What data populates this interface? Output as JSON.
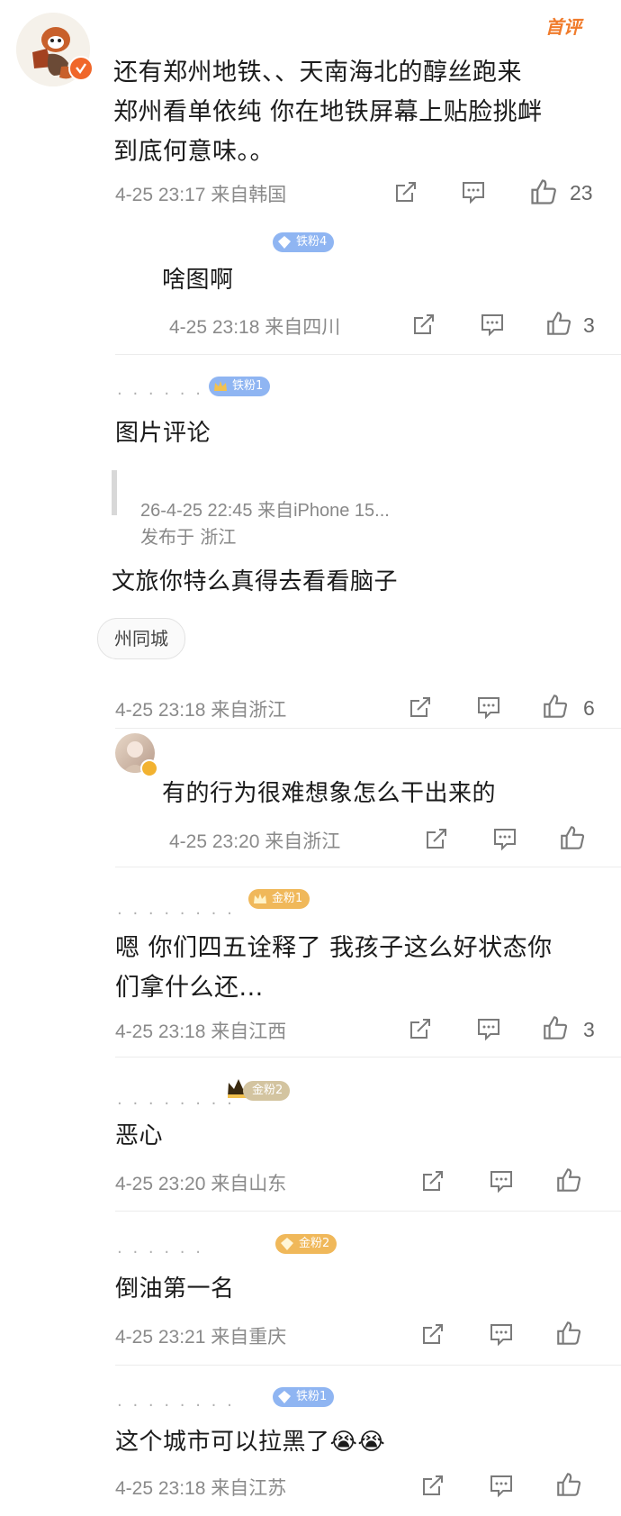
{
  "top_comment": {
    "tag": "首评",
    "lines": [
      "还有郑州地铁、、天南海北的醇丝跑来",
      "郑州看单依纯 你在地铁屏幕上贴脸挑衅",
      "到底何意味。。"
    ],
    "time": "4-25 23:17 来自韩国",
    "likes": "23"
  },
  "replies": [
    {
      "badge": "铁粉4",
      "text": "啥图啊",
      "time": "4-25 23:18 来自四川",
      "likes": "3"
    },
    {
      "badge": "铁粉1",
      "text": "图片评论",
      "quoted_time": "26-4-25 22:45  来自iPhone 15...",
      "quoted_loc": "发布于 浙江",
      "extra_text": "文旅你特么真得去看看脑子",
      "tag": "州同城",
      "time": "4-25 23:18 来自浙江",
      "likes": "6"
    },
    {
      "text": "有的行为很难想象怎么干出来的",
      "time": "4-25 23:20 来自浙江",
      "likes": ""
    },
    {
      "badge": "金粉1",
      "lines": [
        "嗯 你们四五诠释了 我孩子这么好状态你",
        "们拿什么还..."
      ],
      "time": "4-25 23:18 来自江西",
      "likes": "3"
    },
    {
      "badge": "金粉2",
      "text": "恶心",
      "time": "4-25 23:20 来自山东",
      "likes": ""
    },
    {
      "badge": "金粉2",
      "text": "倒油第一名",
      "time": "4-25 23:21 来自重庆",
      "likes": ""
    },
    {
      "badge": "铁粉1",
      "text": "这个城市可以拉黑了😭😭",
      "time": "4-25 23:18 来自江苏",
      "likes": ""
    }
  ],
  "icons": [
    "share-icon",
    "comment-icon",
    "thumbs-up-icon"
  ],
  "colors": {
    "tag": "#f07b2b",
    "badge_blue": "#8fb5f2",
    "badge_gold": "#f0b85a",
    "meta": "#8a8a8a"
  }
}
